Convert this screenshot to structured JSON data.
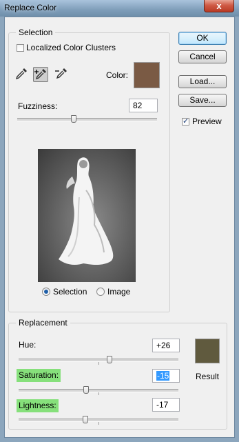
{
  "window": {
    "title": "Replace Color",
    "close_glyph": "x"
  },
  "selection": {
    "legend": "Selection",
    "localized_label": "Localized Color Clusters",
    "localized_checked": false,
    "color_label": "Color:",
    "color_swatch": "#7a5a44",
    "fuzziness_label": "Fuzziness:",
    "fuzziness_value": "82",
    "fuzziness_level": 0.41,
    "view_options": [
      {
        "label": "Selection",
        "selected": true
      },
      {
        "label": "Image",
        "selected": false
      }
    ],
    "tools": [
      "eyedropper-icon",
      "eyedropper-plus-icon",
      "eyedropper-minus-icon"
    ]
  },
  "buttons": {
    "ok": "OK",
    "cancel": "Cancel",
    "load": "Load...",
    "save": "Save..."
  },
  "preview": {
    "label": "Preview",
    "checked": true
  },
  "replacement": {
    "legend": "Replacement",
    "hue_label": "Hue:",
    "hue_value": "+26",
    "hue_level": 0.57,
    "saturation_label": "Saturation:",
    "saturation_value": "-15",
    "saturation_level": 0.43,
    "lightness_label": "Lightness:",
    "lightness_value": "-17",
    "lightness_level": 0.42,
    "result_label": "Result",
    "result_swatch": "#605a3e"
  },
  "colors": {
    "highlight": "#86e07b",
    "selected_text_bg": "#3399ff"
  }
}
